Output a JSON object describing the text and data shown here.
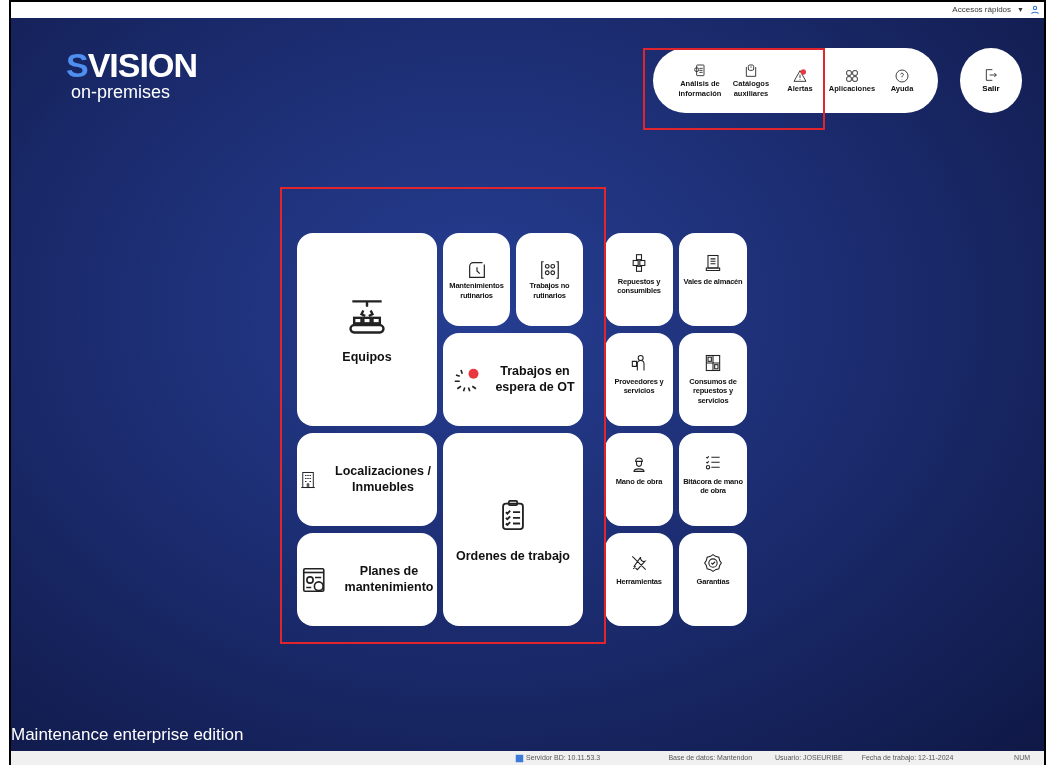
{
  "top_bar": {
    "quick_access": "Accesos rápidos",
    "dropdown": "▼"
  },
  "logo": {
    "prefix": "S",
    "name": "VISION",
    "subtitle": "on-premises"
  },
  "toolbar": [
    {
      "label": "Análisis de información",
      "alert": false
    },
    {
      "label": "Catálogos auxiliares",
      "alert": false
    },
    {
      "label": "Alertas",
      "alert": true
    },
    {
      "label": "Aplicaciones",
      "alert": false
    },
    {
      "label": "Ayuda",
      "alert": false
    }
  ],
  "exit": {
    "label": "Salir"
  },
  "tiles": [
    {
      "label": "Equipos",
      "alert": false
    },
    {
      "label": "Mantenimientos rutinarios",
      "alert": false
    },
    {
      "label": "Trabajos no rutinarios",
      "alert": false
    },
    {
      "label": "Trabajos en espera de OT",
      "alert": true
    },
    {
      "label": "Localizaciones / Inmuebles",
      "alert": false
    },
    {
      "label": "Ordenes de trabajo",
      "alert": false
    },
    {
      "label": "Planes de mantenimiento",
      "alert": false
    }
  ],
  "side_tiles": [
    {
      "label": "Repuestos y consumibles"
    },
    {
      "label": "Vales de almacén"
    },
    {
      "label": "Proveedores y servicios"
    },
    {
      "label": "Consumos de repuestos y servicios"
    },
    {
      "label": "Mano de obra"
    },
    {
      "label": "Bitácora de mano de obra"
    },
    {
      "label": "Herramientas"
    },
    {
      "label": "Garantías"
    }
  ],
  "edition": "Maintenance enterprise edition",
  "status_bar": [
    "Servidor BD: 10.11.53.3",
    "Base de datos: Mantendon",
    "Usuario: JOSEURIBE",
    "Fecha de trabajo: 12-11-2024",
    "NUM"
  ]
}
